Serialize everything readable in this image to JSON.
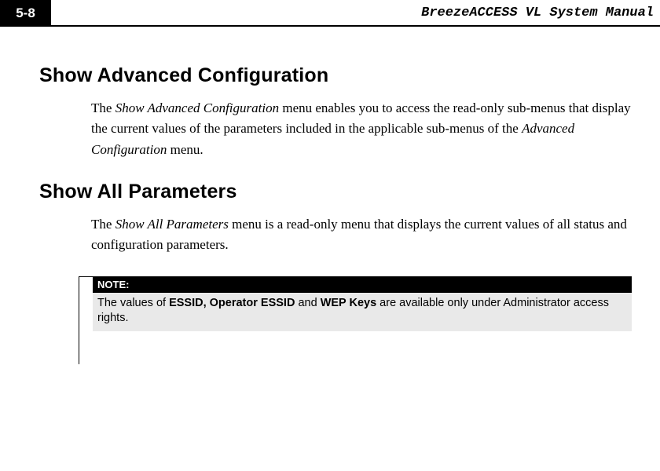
{
  "header": {
    "page_number": "5-8",
    "doc_title": "BreezeACCESS VL System Manual"
  },
  "section1": {
    "heading": "Show Advanced Configuration",
    "p_prefix": "The ",
    "p_italic1": "Show Advanced Configuration",
    "p_mid": " menu enables you to access the read-only sub-menus that display the current values of the parameters included in the applicable sub-menus of the ",
    "p_italic2": "Advanced Configuration",
    "p_suffix": " menu."
  },
  "section2": {
    "heading": "Show All Parameters",
    "p_prefix": "The ",
    "p_italic1": "Show All Parameters",
    "p_suffix": " menu is a read-only menu that displays the current values of all status and configuration parameters."
  },
  "note": {
    "label": "NOTE:",
    "t1": "The values of ",
    "b1": "ESSID, Operator ESSID",
    "t2": " and ",
    "b2": "WEP Keys",
    "t3": " are available only under Administrator access rights."
  }
}
